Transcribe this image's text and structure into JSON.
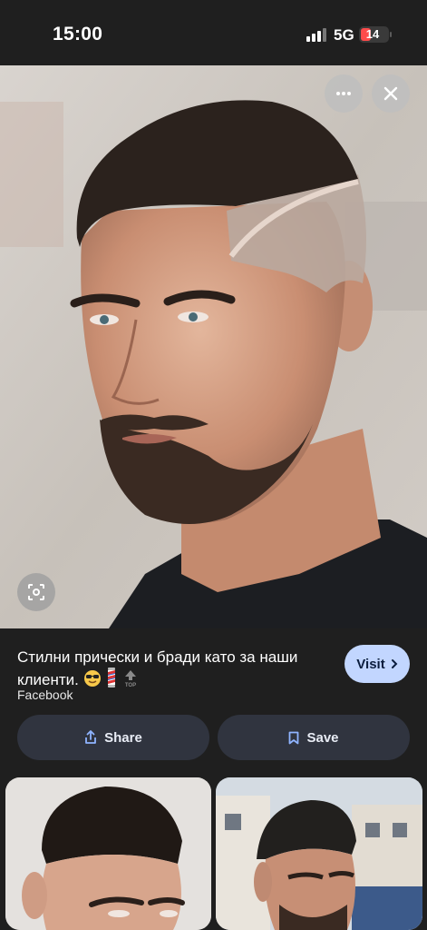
{
  "status_bar": {
    "time": "15:00",
    "network": "5G",
    "battery_level": "14",
    "battery_color": "#ff4b4b"
  },
  "image_viewer": {
    "more_icon": "ellipsis-icon",
    "close_icon": "close-icon",
    "lens_icon": "visual-search-icon"
  },
  "pin": {
    "title": "Стилни прически и бради като за наши клиенти.",
    "title_emojis": [
      "smiling-face-with-sunglasses",
      "barber-pole",
      "top-arrow"
    ],
    "source": "Facebook",
    "visit_label": "Visit",
    "visit_color": "#c2d6ff"
  },
  "actions": {
    "share_label": "Share",
    "save_label": "Save"
  },
  "related_pins": [
    {
      "label": "related-pin-1"
    },
    {
      "label": "related-pin-2"
    }
  ]
}
